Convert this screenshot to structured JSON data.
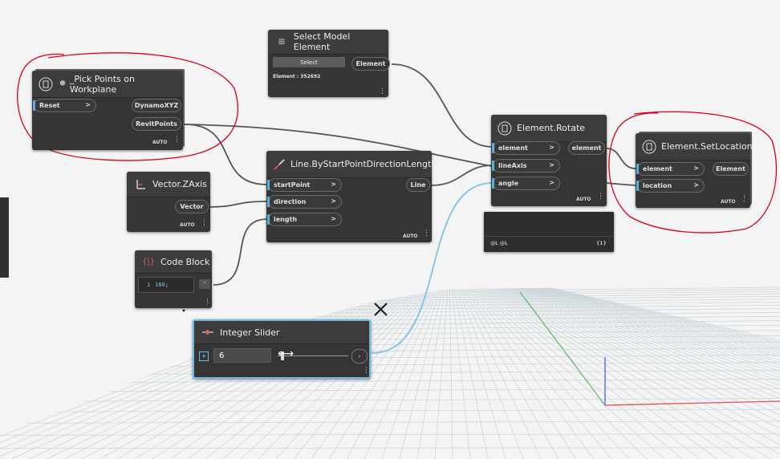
{
  "colors": {
    "node_bg": "#353535",
    "header_bg": "#3c3c3c",
    "wire": "#5a5a5a",
    "wire_active": "#7cc3e6",
    "annotation": "#d9001b",
    "grid": "#c8d3d8",
    "selected_border": "#6ab8e4"
  },
  "nodes": {
    "pick_points": {
      "title": "_Pick Points on Workplane",
      "inputs": [
        "Reset"
      ],
      "outputs": [
        "DynamoXYZ",
        "RevitPoints"
      ],
      "lacing": "AUTO"
    },
    "select_model": {
      "title": "Select Model Element",
      "button": "Select",
      "info": "Element : 352692",
      "outputs": [
        "Element"
      ]
    },
    "line": {
      "title": "Line.ByStartPointDirectionLength",
      "inputs": [
        "startPoint",
        "direction",
        "length"
      ],
      "outputs": [
        "Line"
      ],
      "lacing": "AUTO"
    },
    "vector": {
      "title": "Vector.ZAxis",
      "outputs": [
        "Vector"
      ],
      "lacing": "AUTO"
    },
    "code_block": {
      "title": "Code Block",
      "line_no": "1",
      "code_value": "180",
      "code_semicolon": ";"
    },
    "rotate": {
      "title": "Element.Rotate",
      "inputs": [
        "element",
        "lineAxis",
        "angle"
      ],
      "outputs": [
        "element"
      ],
      "lacing": "AUTO"
    },
    "preview": {
      "left": "@L @L",
      "right": "{1}"
    },
    "set_location": {
      "title": "Element.SetLocation",
      "inputs": [
        "element",
        "location"
      ],
      "outputs": [
        "Element"
      ],
      "lacing": "AUTO"
    },
    "slider": {
      "title": "Integer Slider",
      "value": "6",
      "toggle": "▾"
    }
  },
  "icons": [
    "dynamo-node-icon",
    "points-icon",
    "select-element-icon",
    "line-icon",
    "vector-icon",
    "code-block-icon",
    "slider-icon",
    "cursor-icon",
    "wrench-icon",
    "resize-cursor-icon"
  ]
}
